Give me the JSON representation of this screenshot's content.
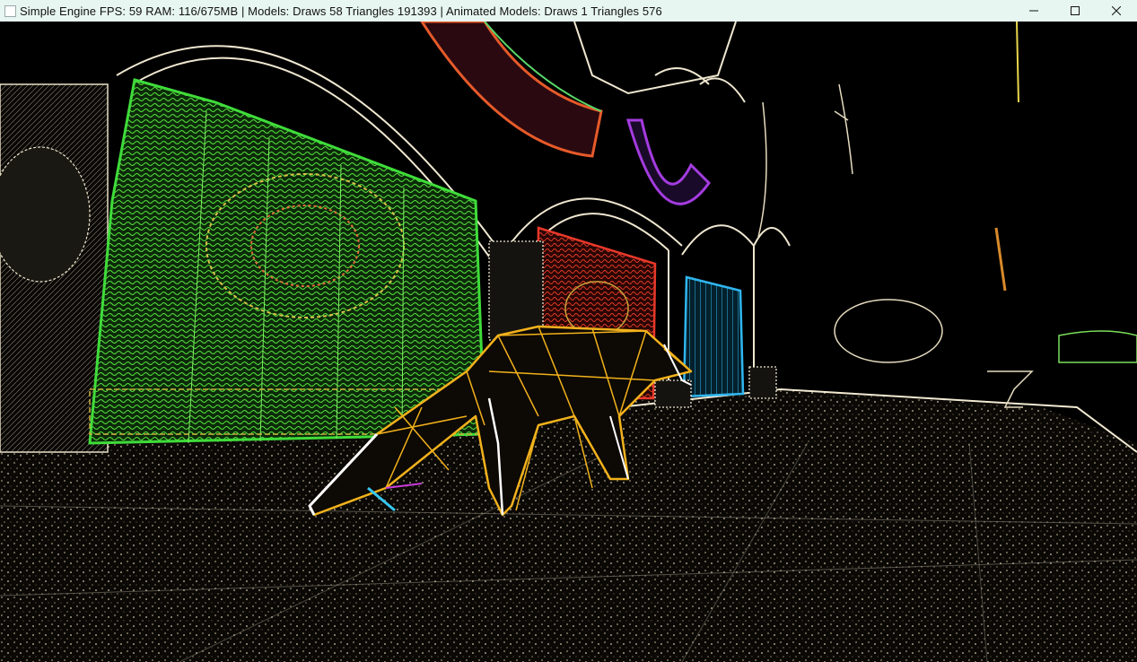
{
  "window": {
    "title": "Simple Engine FPS: 59 RAM: 116/675MB | Models: Draws 58 Triangles 191393 | Animated Models: Draws 1 Triangles 576",
    "controls": {
      "minimize_icon": "minimize-icon",
      "maximize_icon": "maximize-icon",
      "close_icon": "close-icon"
    }
  },
  "viewport": {
    "scene": "edge-detected 3D render of courtyard with arches, curtains and a wireframe fox",
    "colors": {
      "background": "#000000",
      "curtain_green": "#3fdc3a",
      "curtain_red": "#e8382a",
      "curtain_blue": "#2fb6ef",
      "fox_edges": "#f2b21c",
      "stone_edges": "#efe7d0",
      "banner_purple": "#a43ce0"
    }
  }
}
